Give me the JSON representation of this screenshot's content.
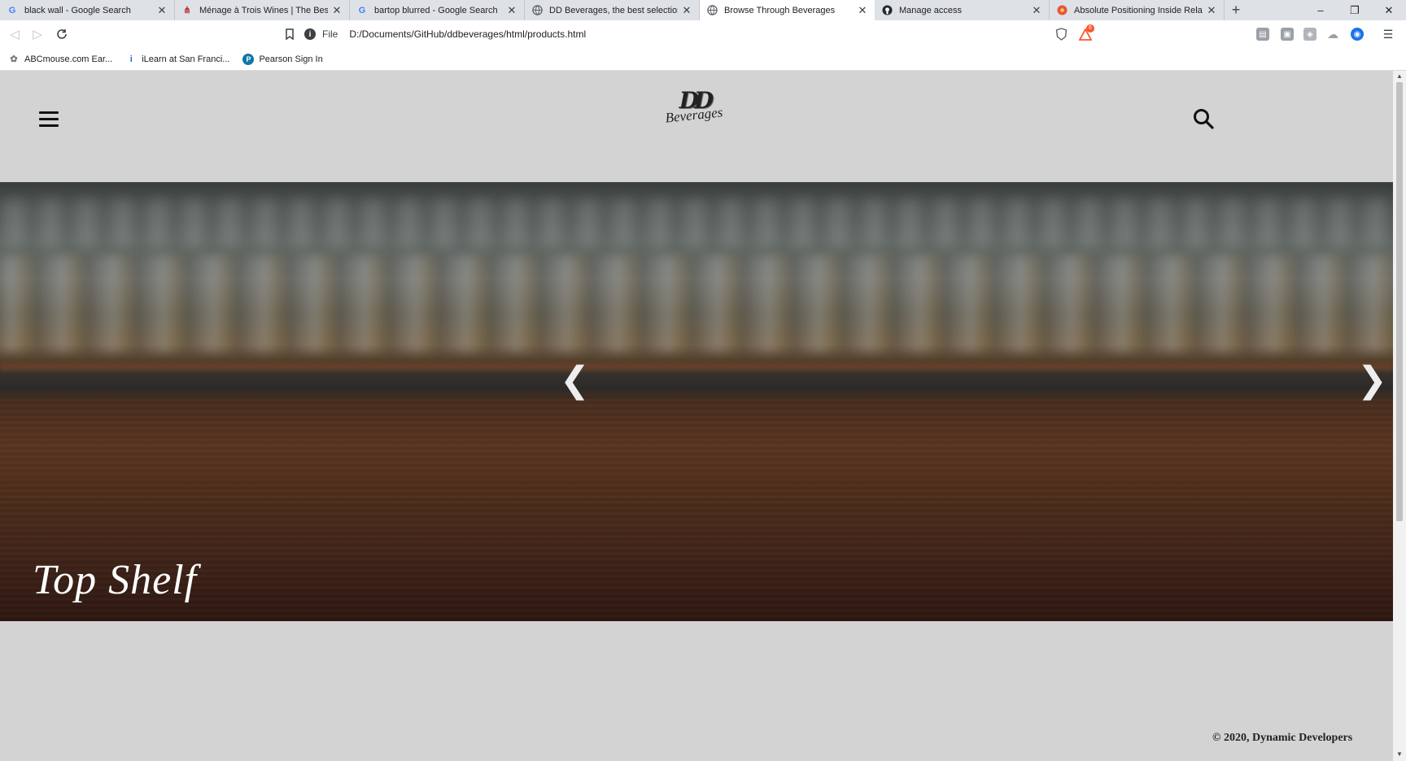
{
  "browser": {
    "tabs": [
      {
        "title": "black wall - Google Search",
        "icon": "google-icon",
        "active": false
      },
      {
        "title": "Ménage à Trois Wines | The Best R",
        "icon": "wine-icon",
        "active": false
      },
      {
        "title": "bartop blurred - Google Search",
        "icon": "google-icon",
        "active": false
      },
      {
        "title": "DD Beverages, the best selection o",
        "icon": "globe-icon",
        "active": false
      },
      {
        "title": "Browse Through Beverages",
        "icon": "globe-icon",
        "active": true
      },
      {
        "title": "Manage access",
        "icon": "github-icon",
        "active": false
      },
      {
        "title": "Absolute Positioning Inside Relativ",
        "icon": "css-tricks-icon",
        "active": false
      }
    ],
    "url_scheme": "File",
    "url": "D:/Documents/GitHub/ddbeverages/html/products.html",
    "bookmarks": [
      {
        "label": "ABCmouse.com Ear...",
        "icon": "abcmouse-icon"
      },
      {
        "label": "iLearn at San Franci...",
        "icon": "info-icon"
      },
      {
        "label": "Pearson Sign In",
        "icon": "pearson-icon"
      }
    ],
    "notification_badge": "6"
  },
  "page": {
    "logo_mono": "DD",
    "logo_word": "Beverages",
    "hero_title": "Top Shelf",
    "prev_arrow": "❮",
    "next_arrow": "❯",
    "footer": "© 2020, Dynamic Developers"
  },
  "colors": {
    "page_bg": "#d3d3d3",
    "brave_orange": "#fb542b",
    "hero_text": "#ffffff"
  }
}
